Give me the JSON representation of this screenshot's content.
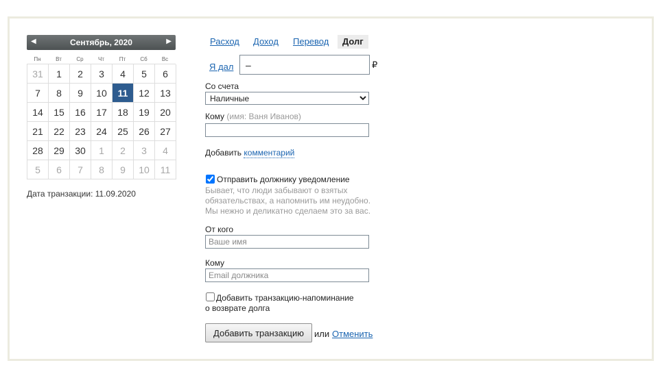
{
  "calendar": {
    "title": "Сентябрь, 2020",
    "prev_icon": "◀",
    "next_icon": "▶",
    "weekdays": [
      "Пн",
      "Вт",
      "Ср",
      "Чт",
      "Пт",
      "Сб",
      "Вс"
    ],
    "weeks": [
      [
        "31",
        "1",
        "2",
        "3",
        "4",
        "5",
        "6"
      ],
      [
        "7",
        "8",
        "9",
        "10",
        "11",
        "12",
        "13"
      ],
      [
        "14",
        "15",
        "16",
        "17",
        "18",
        "19",
        "20"
      ],
      [
        "21",
        "22",
        "23",
        "24",
        "25",
        "26",
        "27"
      ],
      [
        "28",
        "29",
        "30",
        "1",
        "2",
        "3",
        "4"
      ],
      [
        "5",
        "6",
        "7",
        "8",
        "9",
        "10",
        "11"
      ]
    ],
    "selected_day": "11",
    "transaction_date": "Дата транзакции: 11.09.2020"
  },
  "tabs": [
    {
      "label": "Расход",
      "active": false
    },
    {
      "label": "Доход",
      "active": false
    },
    {
      "label": "Перевод",
      "active": false
    },
    {
      "label": "Долг",
      "active": true
    }
  ],
  "form": {
    "direction_link": "Я дал",
    "amount_value": "–",
    "currency": "₽",
    "from_account_label": "Со счета",
    "from_account_selected": "Наличные",
    "to_label": "Кому",
    "to_hint": "(имя: Ваня Иванов)",
    "to_value": "",
    "comment_prefix": "Добавить",
    "comment_link": "комментарий",
    "notify_label": "Отправить должнику уведомление",
    "notify_checked": true,
    "notify_note_lines": [
      "Бывает, что люди забывают о взятых",
      "обязательствах, а напомнить им неудобно.",
      "Мы нежно и деликатно сделаем это за вас."
    ],
    "from_label": "От кого",
    "from_placeholder": "Ваше имя",
    "recipient_label": "Кому",
    "recipient_placeholder": "Email должника",
    "reminder_line1": "Добавить транзакцию-напоминание",
    "reminder_line2": "о возврате долга",
    "reminder_checked": false,
    "submit_label": "Добавить транзакцию",
    "or_text": "или",
    "cancel_link": "Отменить"
  },
  "colors": {
    "selected_day": "#2e5c8f",
    "link": "#1a64b0",
    "frame_border": "#ecebdf"
  }
}
